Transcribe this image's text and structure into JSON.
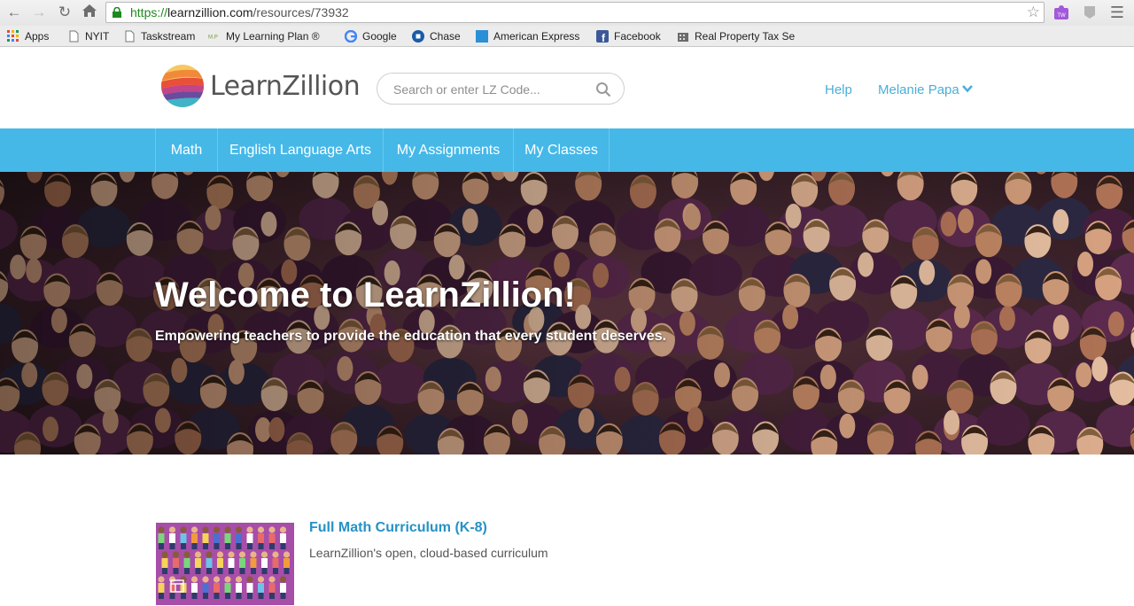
{
  "browser": {
    "url_secure": "https://",
    "url_domain": "learnzillion.com",
    "url_path": "/resources/73932",
    "bookmarks": [
      {
        "label": "Apps"
      },
      {
        "label": "NYIT"
      },
      {
        "label": "Taskstream"
      },
      {
        "label": "My Learning Plan ®"
      },
      {
        "label": "Google"
      },
      {
        "label": "Chase"
      },
      {
        "label": "American Express"
      },
      {
        "label": "Facebook"
      },
      {
        "label": "Real Property Tax Se"
      }
    ]
  },
  "header": {
    "logo_text": "LearnZillion",
    "search_placeholder": "Search or enter LZ Code...",
    "help_label": "Help",
    "user_name": "Melanie Papa"
  },
  "nav": {
    "items": [
      {
        "label": "Math"
      },
      {
        "label": "English Language Arts"
      },
      {
        "label": "My Assignments"
      },
      {
        "label": "My Classes"
      }
    ]
  },
  "hero": {
    "title": "Welcome to LearnZillion!",
    "subtitle": "Empowering teachers to provide the education that every student deserves."
  },
  "resource": {
    "title": "Full Math Curriculum (K-8)",
    "description": "LearnZillion's open, cloud-based curriculum"
  },
  "colors": {
    "nav_bg": "#45b8e8",
    "link": "#4aaed9",
    "resource_title": "#2592c6",
    "thumb_bg": "#a64ea8"
  }
}
